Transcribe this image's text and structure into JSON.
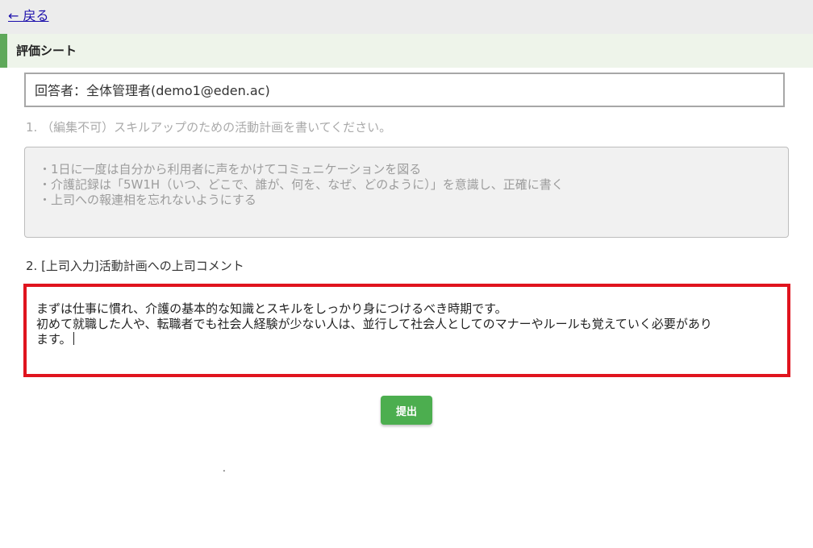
{
  "nav": {
    "back_label": "← 戻る"
  },
  "section": {
    "title": "評価シート",
    "accent_color": "#5fa85a"
  },
  "respondent": {
    "text": "回答者：全体管理者(demo1@eden.ac)"
  },
  "question1": {
    "label": "1. （編集不可）スキルアップのための活動計画を書いてください。",
    "answer_lines": [
      "・1日に一度は自分から利用者に声をかけてコミュニケーションを図る",
      "・介護記録は「5W1H（いつ、どこで、誰が、何を、なぜ、どのように）」を意識し、正確に書く",
      "・上司への報連相を忘れないようにする"
    ]
  },
  "question2": {
    "label": "2. [上司入力]活動計画への上司コメント",
    "answer_lines": [
      "まずは仕事に慣れ、介護の基本的な知識とスキルをしっかり身につけるべき時期です。",
      "初めて就職した人や、転職者でも社会人経験が少ない人は、並行して社会人としてのマナーやルールも覚えていく必要があり",
      "ます。"
    ],
    "highlight_color": "#e0141e"
  },
  "actions": {
    "submit_label": "提出",
    "submit_color": "#4cae4f"
  },
  "stray_dot": "."
}
